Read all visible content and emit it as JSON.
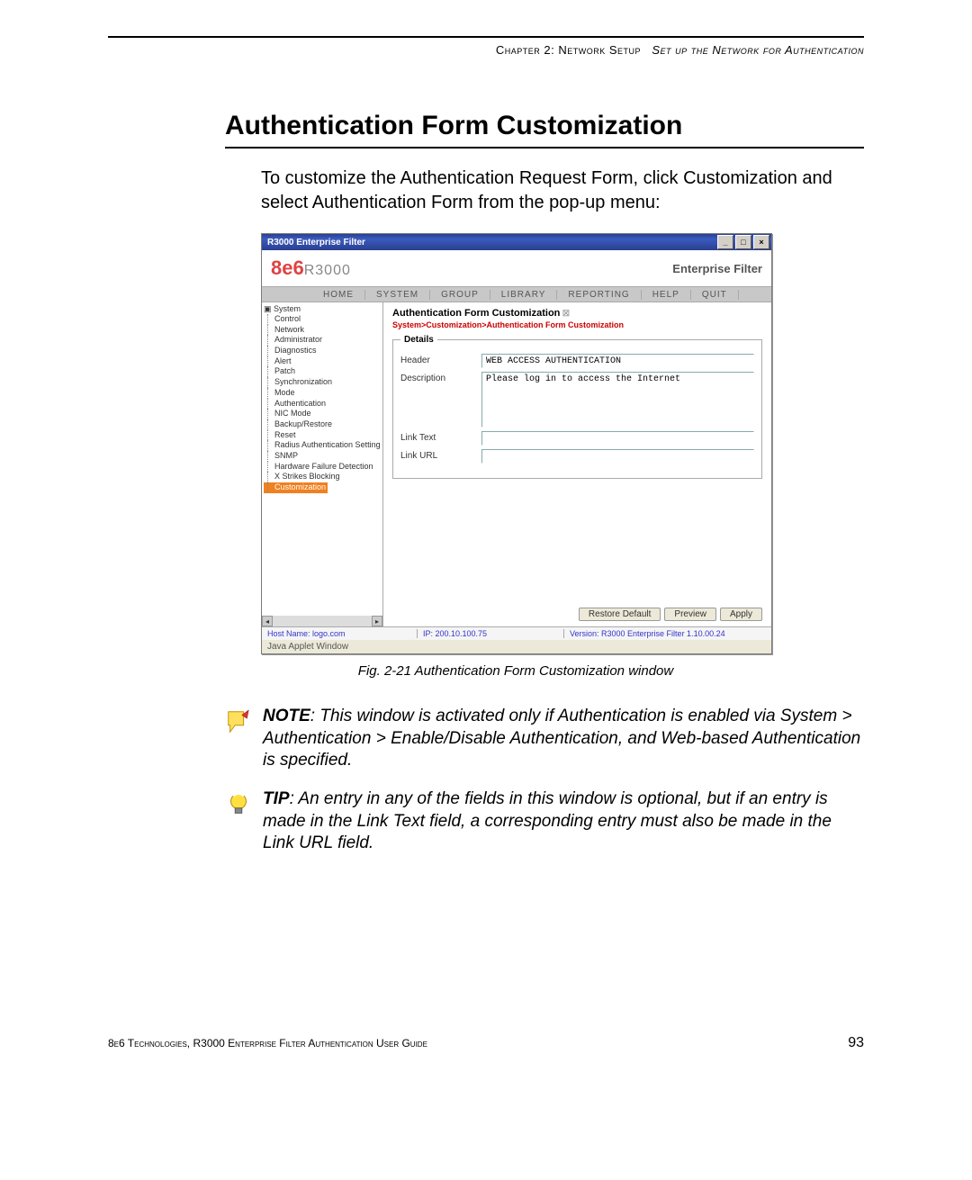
{
  "header": {
    "chapter": "Chapter 2: Network Setup",
    "section_italic": "Set up the Network for Authentication"
  },
  "section_title": "Authentication Form Customization",
  "intro_paragraph": "To customize the Authentication Request Form, click Customization and select Authentication Form from the pop-up menu:",
  "window": {
    "title": "R3000 Enterprise Filter",
    "logo_left": "8e6",
    "logo_right": "R3000",
    "brand_right": "Enterprise Filter",
    "tabs": [
      "HOME",
      "SYSTEM",
      "GROUP",
      "LIBRARY",
      "REPORTING",
      "HELP",
      "QUIT"
    ],
    "tree_root": "System",
    "tree_items": [
      "Control",
      "Network",
      "Administrator",
      "Diagnostics",
      "Alert",
      "Patch",
      "Synchronization",
      "Mode",
      "Authentication",
      "NIC Mode",
      "Backup/Restore",
      "Reset",
      "Radius Authentication Setting",
      "SNMP",
      "Hardware Failure Detection",
      "X Strikes Blocking",
      "Customization"
    ],
    "tree_selected": "Customization",
    "panel_title": "Authentication Form Customization",
    "breadcrumb": "System>Customization>Authentication Form Customization",
    "fieldset_legend": "Details",
    "fields": {
      "header": {
        "label": "Header",
        "value": "WEB ACCESS AUTHENTICATION"
      },
      "description": {
        "label": "Description",
        "value": "Please log in to access the Internet"
      },
      "link_text": {
        "label": "Link Text",
        "value": ""
      },
      "link_url": {
        "label": "Link URL",
        "value": ""
      }
    },
    "buttons": {
      "restore": "Restore Default",
      "preview": "Preview",
      "apply": "Apply"
    },
    "status": {
      "host": "Host Name: logo.com",
      "ip": "IP: 200.10.100.75",
      "version": "Version: R3000 Enterprise Filter 1.10.00.24"
    },
    "applet_label": "Java Applet Window"
  },
  "figure_caption": "Fig. 2-21  Authentication Form Customization window",
  "note": {
    "bold": "NOTE",
    "text": ": This window is activated only if Authentication is enabled via System > Authentication > Enable/Disable Authentication, and Web-based Authentication is specified."
  },
  "tip": {
    "bold": "TIP",
    "text": ": An entry in any of the fields in this window is optional, but if an entry is made in the Link Text field, a corresponding entry must also be made in the Link URL field."
  },
  "footer": {
    "left": "8e6 Technologies, R3000 Enterprise Filter Authentication User Guide",
    "page": "93"
  }
}
